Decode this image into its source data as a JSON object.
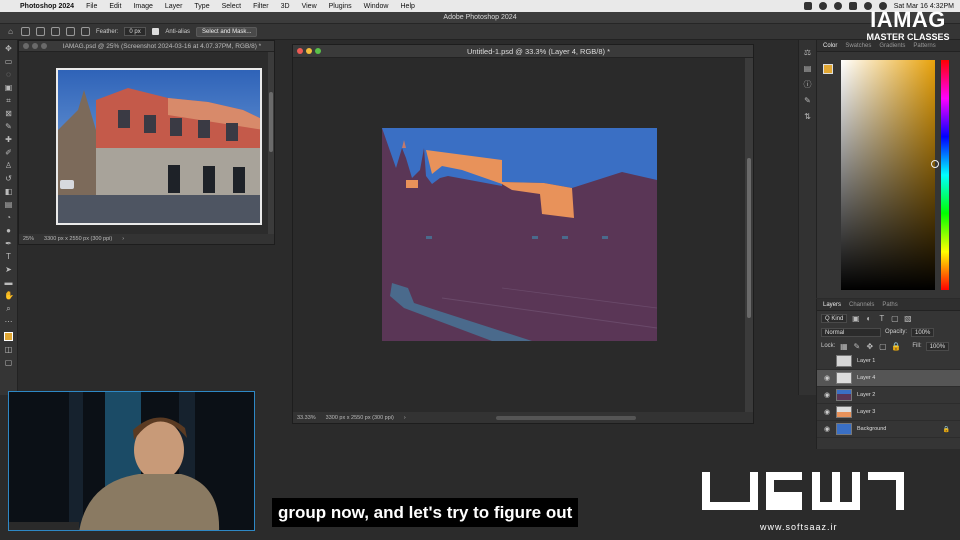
{
  "menubar": {
    "app_name": "Photoshop 2024",
    "items": [
      "File",
      "Edit",
      "Image",
      "Layer",
      "Type",
      "Select",
      "Filter",
      "3D",
      "View",
      "Plugins",
      "Window",
      "Help"
    ],
    "datetime": "Sat Mar 16  4:32PM"
  },
  "window_title": "Adobe Photoshop 2024",
  "options_bar": {
    "feather_label": "Feather:",
    "feather_value": "0 px",
    "antialias_label": "Anti-alias",
    "select_mask_label": "Select and Mask..."
  },
  "doc1": {
    "title": "IAMAG.psd @ 25% (Screenshot 2024-03-16 at 4.07.37PM, RGB/8) *",
    "zoom": "25%",
    "dimensions": "3300 px x 2550 px (300 ppi)"
  },
  "doc2": {
    "title": "Untitled-1.psd @ 33.3% (Layer 4, RGB/8) *",
    "zoom": "33.33%",
    "dimensions": "3300 px x 2550 px (300 ppi)"
  },
  "color_panel": {
    "tabs": [
      "Color",
      "Swatches",
      "Gradients",
      "Patterns"
    ],
    "fg_color": "#e1a734"
  },
  "layers_panel": {
    "tabs": [
      "Layers",
      "Channels",
      "Paths"
    ],
    "kind_label": "Q Kind",
    "blend_mode": "Normal",
    "opacity_label": "Opacity:",
    "opacity_value": "100%",
    "lock_label": "Lock:",
    "fill_label": "Fill:",
    "fill_value": "100%",
    "layers": [
      {
        "name": "Layer 1",
        "visible": false,
        "selected": false
      },
      {
        "name": "Layer 4",
        "visible": true,
        "selected": true
      },
      {
        "name": "Layer 2",
        "visible": true,
        "selected": false
      },
      {
        "name": "Layer 3",
        "visible": true,
        "selected": false
      },
      {
        "name": "Background",
        "visible": true,
        "selected": false,
        "locked": true
      }
    ]
  },
  "subtitle": "group now, and let's try to figure out",
  "watermark": {
    "brand": "IAMAG",
    "brand_sub": "MASTER CLASSES",
    "url": "www.softsaaz.ir"
  },
  "colors": {
    "sky": "#3a6fc4",
    "building_orange": "#e8925a",
    "shadow_purple": "#5a3656",
    "street_blue": "#4a6a8c",
    "accent_fg": "#e1a734"
  }
}
